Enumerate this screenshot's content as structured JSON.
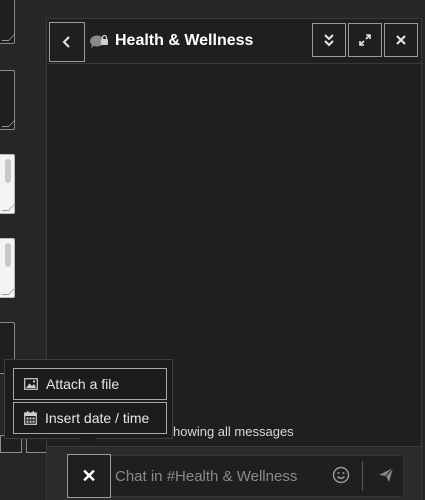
{
  "chat": {
    "title": "Health & Wellness",
    "status_text": "howing all messages",
    "input_placeholder": "Chat in #Health & Wellness"
  },
  "header_buttons": {
    "back": "chevron-left-icon",
    "collapse": "double-chevron-down-icon",
    "expand": "expand-icon",
    "close": "close-icon"
  },
  "menu": {
    "items": [
      {
        "label": "Attach a file",
        "icon": "image-icon"
      },
      {
        "label": "Insert date / time",
        "icon": "calendar-icon"
      }
    ]
  },
  "composer": {
    "toggle_symbol": "✕",
    "emoji_icon": "emoji-icon",
    "send_icon": "send-icon"
  },
  "colors": {
    "background": "#262626",
    "panel": "#1f1f1f",
    "border": "#9a9a9a",
    "text": "#e6e6e6"
  }
}
